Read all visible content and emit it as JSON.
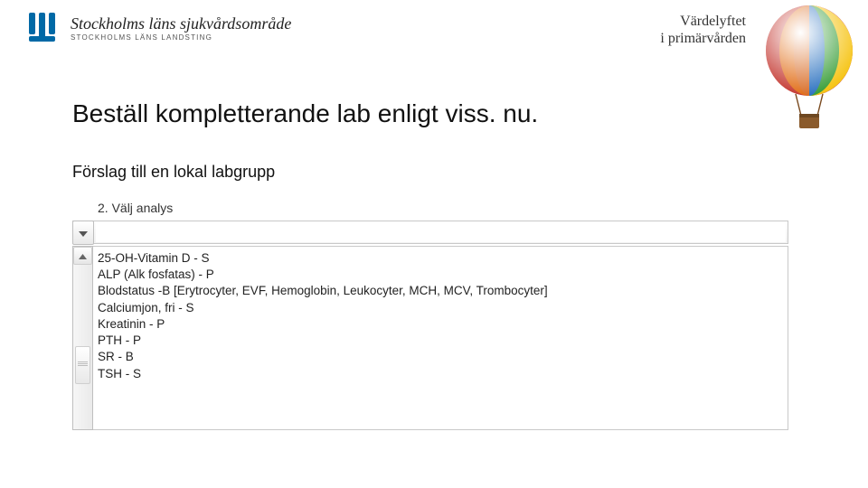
{
  "header": {
    "org_main": "Stockholms läns sjukvårdsområde",
    "org_sub": "STOCKHOLMS LÄNS LANDSTING",
    "tagline_line1": "Värdelyftet",
    "tagline_line2": "i primärvården"
  },
  "main": {
    "title": "Beställ kompletterande lab enligt viss. nu.",
    "subtitle": "Förslag till en lokal labgrupp"
  },
  "panel": {
    "heading": "2. Välj analys",
    "search_value": "",
    "items": [
      "25-OH-Vitamin D - S",
      "ALP (Alk fosfatas) - P",
      "Blodstatus -B   [Erytrocyter, EVF, Hemoglobin, Leukocyter, MCH, MCV, Trombocyter]",
      "Calciumjon, fri - S",
      "Kreatinin - P",
      "PTH - P",
      "SR - B",
      "TSH - S"
    ]
  }
}
